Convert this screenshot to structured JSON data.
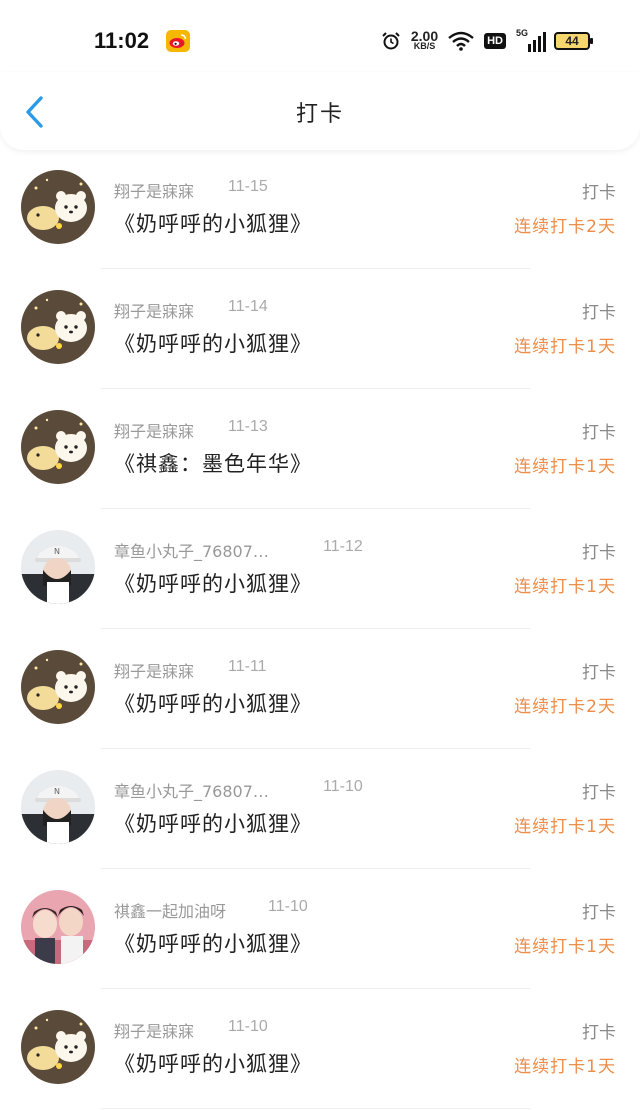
{
  "status_bar": {
    "time": "11:02",
    "net_speed_value": "2.00",
    "net_speed_unit": "KB/S",
    "hd": "HD",
    "network": "5G",
    "battery": "44",
    "icons": [
      "weibo-icon",
      "alarm-icon",
      "wifi-icon",
      "signal-icon",
      "battery-icon"
    ]
  },
  "nav": {
    "title": "打卡",
    "back_icon": "chevron-left-icon"
  },
  "colors": {
    "accent_blue": "#2b9be8",
    "streak_orange": "#ee8c4a",
    "muted_gray": "#999999"
  },
  "items": [
    {
      "name": "翔子是寐寐",
      "date": "11-15",
      "title": "《奶呼呼的小狐狸》",
      "action": "打卡",
      "streak": "连续打卡2天",
      "avatar": "bear"
    },
    {
      "name": "翔子是寐寐",
      "date": "11-14",
      "title": "《奶呼呼的小狐狸》",
      "action": "打卡",
      "streak": "连续打卡1天",
      "avatar": "bear"
    },
    {
      "name": "翔子是寐寐",
      "date": "11-13",
      "title": "《祺鑫：墨色年华》",
      "action": "打卡",
      "streak": "连续打卡1天",
      "avatar": "bear"
    },
    {
      "name": "章鱼小丸子_76807…",
      "date": "11-12",
      "title": "《奶呼呼的小狐狸》",
      "action": "打卡",
      "streak": "连续打卡1天",
      "avatar": "cap"
    },
    {
      "name": "翔子是寐寐",
      "date": "11-11",
      "title": "《奶呼呼的小狐狸》",
      "action": "打卡",
      "streak": "连续打卡2天",
      "avatar": "bear"
    },
    {
      "name": "章鱼小丸子_76807…",
      "date": "11-10",
      "title": "《奶呼呼的小狐狸》",
      "action": "打卡",
      "streak": "连续打卡1天",
      "avatar": "cap"
    },
    {
      "name": "祺鑫一起加油呀",
      "date": "11-10",
      "title": "《奶呼呼的小狐狸》",
      "action": "打卡",
      "streak": "连续打卡1天",
      "avatar": "pair"
    },
    {
      "name": "翔子是寐寐",
      "date": "11-10",
      "title": "《奶呼呼的小狐狸》",
      "action": "打卡",
      "streak": "连续打卡1天",
      "avatar": "bear"
    }
  ]
}
